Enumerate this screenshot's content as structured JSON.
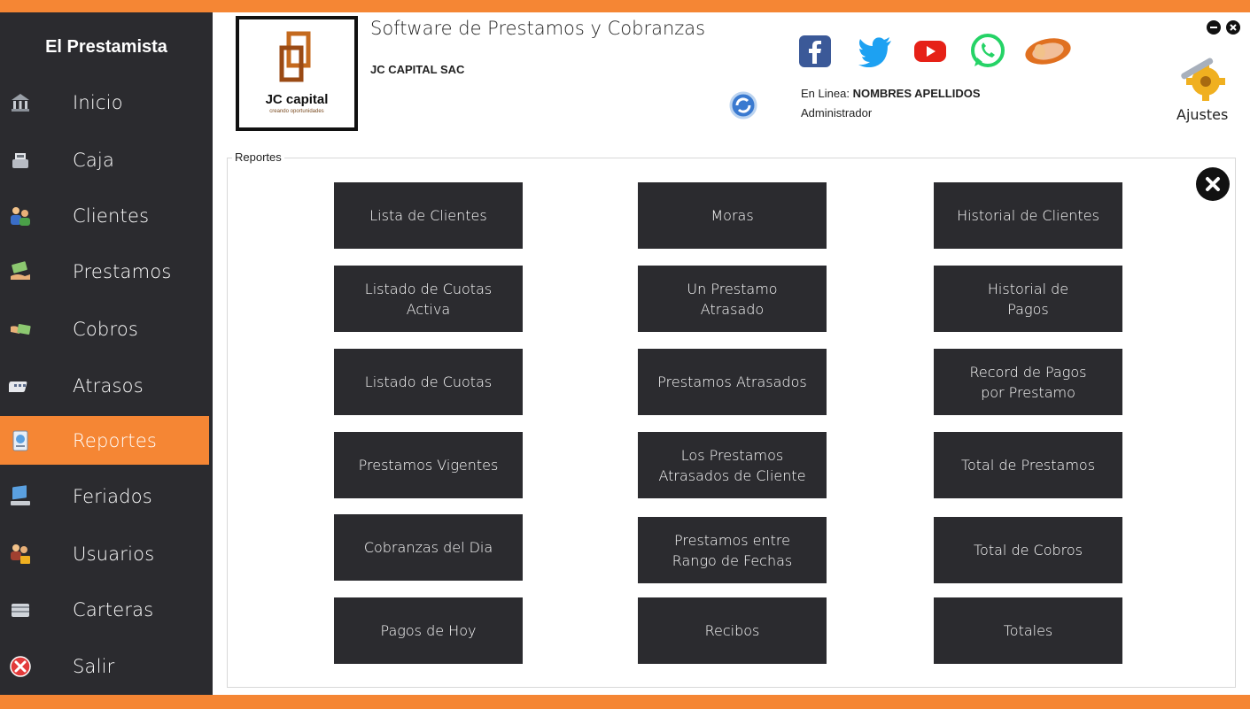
{
  "app": {
    "brand": "El Prestamista",
    "title": "Software de Prestamos y Cobranzas",
    "company": "JC CAPITAL SAC",
    "logo_text": "JC capital",
    "logo_sub": "creando oportunidades",
    "online_label": "En Linea:",
    "online_user": "NOMBRES APELLIDOS",
    "role": "Administrador",
    "settings_label": "Ajustes"
  },
  "colors": {
    "accent": "#f58634",
    "sidebar": "#2b2b2f",
    "button": "#2b2b2f"
  },
  "sidebar": {
    "items": [
      {
        "label": "Inicio",
        "icon": "bank-icon"
      },
      {
        "label": "Caja",
        "icon": "cash-register-icon"
      },
      {
        "label": "Clientes",
        "icon": "clients-icon"
      },
      {
        "label": "Prestamos",
        "icon": "money-hand-icon"
      },
      {
        "label": "Cobros",
        "icon": "money-receive-icon"
      },
      {
        "label": "Atrasos",
        "icon": "calendar-icon"
      },
      {
        "label": "Reportes",
        "icon": "report-icon",
        "active": true
      },
      {
        "label": "Feriados",
        "icon": "computer-icon"
      },
      {
        "label": "Usuarios",
        "icon": "users-lock-icon"
      },
      {
        "label": "Carteras",
        "icon": "wallet-icon"
      },
      {
        "label": "Salir",
        "icon": "exit-icon"
      }
    ]
  },
  "reports": {
    "group_label": "Reportes",
    "buttons": [
      "Lista de Clientes",
      "Moras",
      "Historial de Clientes",
      "Listado de Cuotas\nActiva",
      "Un Prestamo\nAtrasado",
      "Historial de\nPagos",
      "Listado de Cuotas",
      "Prestamos Atrasados",
      "Record de Pagos\npor Prestamo",
      "Prestamos Vigentes",
      "Los Prestamos\nAtrasados de Cliente",
      "Total de Prestamos",
      "Cobranzas del Dia",
      "Prestamos entre\nRango de Fechas",
      "Total de Cobros",
      "Pagos de Hoy",
      "Recibos",
      "Totales"
    ]
  },
  "social": [
    "facebook-icon",
    "twitter-icon",
    "youtube-icon",
    "whatsapp-icon",
    "mouse-icon"
  ]
}
